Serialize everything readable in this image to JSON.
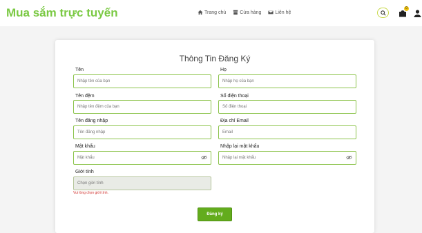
{
  "header": {
    "brand": "Mua sắm trực tuyến",
    "nav": [
      {
        "label": "Trang chủ",
        "icon": "home-icon"
      },
      {
        "label": "Cửa hàng",
        "icon": "store-icon"
      },
      {
        "label": "Liên hệ",
        "icon": "mail-icon"
      }
    ],
    "cart_count": "0",
    "brand_color": "#7ac943"
  },
  "form": {
    "title": "Thông Tin Đăng Ký",
    "first_name": {
      "label": "Tên",
      "placeholder": "Nhập tên của bạn"
    },
    "last_name": {
      "label": "Họ",
      "placeholder": "Nhập họ của bạn"
    },
    "middle_name": {
      "label": "Tên đệm",
      "placeholder": "Nhập tên đệm của bạn"
    },
    "phone": {
      "label": "Số điện thoại",
      "placeholder": "Số điện thoại"
    },
    "username": {
      "label": "Tên đăng nhập",
      "placeholder": "Tên đăng nhập"
    },
    "email": {
      "label": "Địa chỉ Email",
      "placeholder": "Email"
    },
    "password": {
      "label": "Mật khẩu",
      "placeholder": "Mật khẩu"
    },
    "confirm_password": {
      "label": "Nhập lại mật khẩu",
      "placeholder": "Nhập lại mật khẩu"
    },
    "gender": {
      "label": "Giới tính",
      "placeholder": "Chọn giới tính",
      "error": "Vui lòng chọn giới tính."
    },
    "submit_label": "Đăng ký",
    "accent_color": "#63ac1d",
    "error_color": "#d0312d"
  }
}
